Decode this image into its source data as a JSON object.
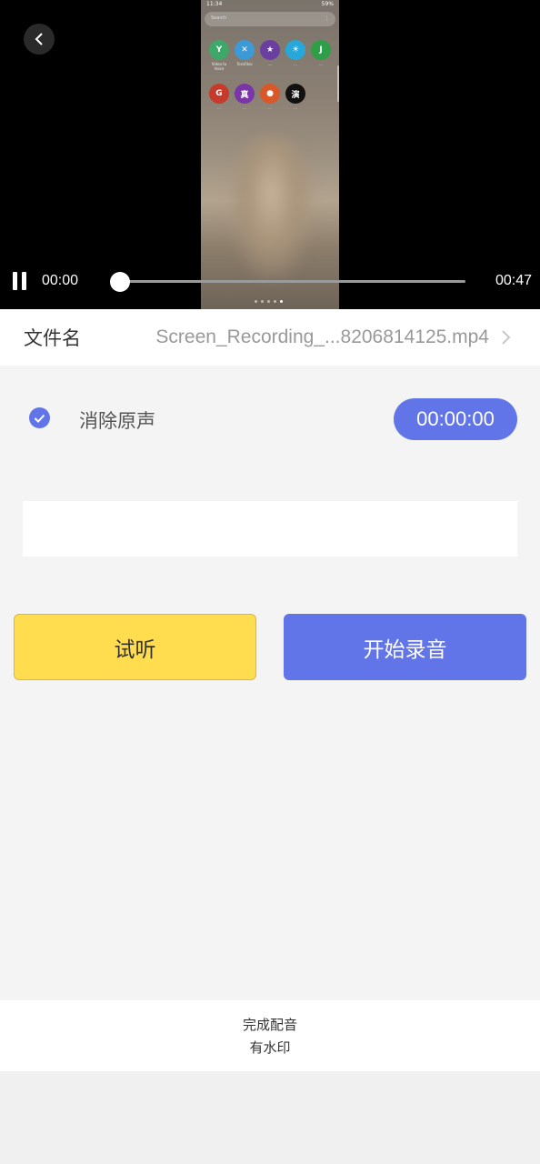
{
  "video": {
    "current_time": "00:00",
    "duration": "00:47",
    "progress": 0,
    "phone_preview": {
      "status_time": "11:34",
      "status_right": "59%",
      "search_placeholder": "Search",
      "apps": [
        {
          "icon": "green-leaf-icon",
          "glyph": "Y",
          "color": "#3ea86b",
          "label": "Video to Voice"
        },
        {
          "icon": "tool-icon",
          "glyph": "✕",
          "color": "#3d9ad6",
          "label": "TeraFiles"
        },
        {
          "icon": "game-badge-icon",
          "glyph": "★",
          "color": "#6a3fa0",
          "label": "...."
        },
        {
          "icon": "sun-icon",
          "glyph": "☀",
          "color": "#28a8d8",
          "label": "..."
        },
        {
          "icon": "jian-icon",
          "glyph": "J",
          "color": "#2f9e48",
          "label": "..."
        },
        {
          "icon": "red-badge-icon",
          "glyph": "G",
          "color": "#c63a2b",
          "label": "..."
        },
        {
          "icon": "zhen-icon",
          "glyph": "真",
          "color": "#7a35a8",
          "label": "..."
        },
        {
          "icon": "orange-badge-icon",
          "glyph": "●",
          "color": "#d9582a",
          "label": "..."
        },
        {
          "icon": "yan-icon",
          "glyph": "演",
          "color": "#111111",
          "label": "..."
        }
      ]
    }
  },
  "file": {
    "label": "文件名",
    "value": "Screen_Recording_...8206814125.mp4"
  },
  "options": {
    "mute_original_label": "消除原声",
    "mute_original_checked": true,
    "timer": "00:00:00"
  },
  "text_input": {
    "value": ""
  },
  "buttons": {
    "listen": "试听",
    "record": "开始录音"
  },
  "bottom": {
    "line1": "完成配音",
    "line2": "有水印"
  },
  "colors": {
    "accent": "#6275e8",
    "listen_button": "#ffdd4f"
  }
}
